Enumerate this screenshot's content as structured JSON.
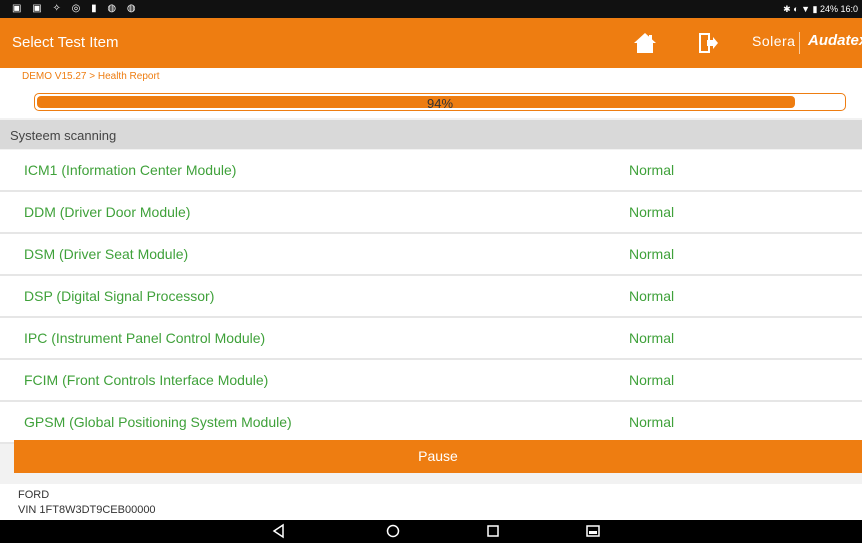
{
  "statusbar": {
    "time": "16:0",
    "battery_pct": "24%"
  },
  "appbar": {
    "title": "Select Test Item",
    "solera": "Solera",
    "audatex": "Audatex"
  },
  "breadcrumb": "DEMO V15.27 > Health Report",
  "progress": {
    "value": 94,
    "label": "94%"
  },
  "section_title": "Systeem scanning",
  "modules": [
    {
      "name": "ICM1 (Information Center Module)",
      "status": "Normal"
    },
    {
      "name": "DDM (Driver Door Module)",
      "status": "Normal"
    },
    {
      "name": "DSM (Driver Seat Module)",
      "status": "Normal"
    },
    {
      "name": "DSP (Digital Signal Processor)",
      "status": "Normal"
    },
    {
      "name": "IPC (Instrument Panel Control Module)",
      "status": "Normal"
    },
    {
      "name": "FCIM (Front Controls Interface Module)",
      "status": "Normal"
    },
    {
      "name": "GPSM (Global Positioning System Module)",
      "status": "Normal"
    }
  ],
  "pause_label": "Pause",
  "footer": {
    "make": "FORD",
    "vin": "VIN 1FT8W3DT9CEB00000"
  },
  "icons": [
    "home-icon",
    "exit-icon",
    "back-icon",
    "home-circle-icon",
    "recent-apps-icon",
    "screenshot-icon"
  ],
  "colors": {
    "accent": "#ee7d11",
    "status_green": "#3fa13a"
  }
}
